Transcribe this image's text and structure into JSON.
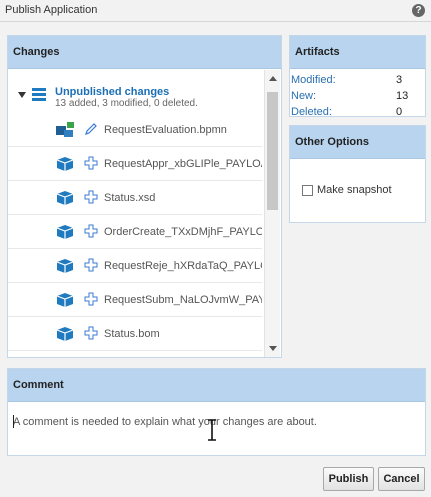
{
  "dialog": {
    "title": "Publish Application",
    "help_label": "?"
  },
  "changes": {
    "header": "Changes",
    "root": {
      "title": "Unpublished changes",
      "subtitle": "13 added, 3 modified, 0 deleted."
    },
    "items": [
      {
        "name": "RequestEvaluation.bpmn",
        "status": "modified",
        "icon": "process-icon"
      },
      {
        "name": "RequestAppr_xbGLIPle_PAYLOAD",
        "status": "added",
        "icon": "package-icon"
      },
      {
        "name": "Status.xsd",
        "status": "added",
        "icon": "package-icon"
      },
      {
        "name": "OrderCreate_TXxDMjhF_PAYLOAD",
        "status": "added",
        "icon": "package-icon"
      },
      {
        "name": "RequestReje_hXRdaTaQ_PAYLOAD",
        "status": "added",
        "icon": "package-icon"
      },
      {
        "name": "RequestSubm_NaLOJvmW_PAYLOAD",
        "status": "added",
        "icon": "package-icon"
      },
      {
        "name": "Status.bom",
        "status": "added",
        "icon": "package-icon"
      }
    ]
  },
  "artifacts": {
    "header": "Artifacts",
    "rows": [
      {
        "label": "Modified:",
        "value": "3"
      },
      {
        "label": "New:",
        "value": "13"
      },
      {
        "label": "Deleted:",
        "value": "0"
      }
    ]
  },
  "options": {
    "header": "Other Options",
    "snapshot_label": "Make snapshot",
    "snapshot_checked": false
  },
  "comment": {
    "header": "Comment",
    "placeholder": "A comment is needed to explain what your changes are about."
  },
  "buttons": {
    "publish": "Publish",
    "cancel": "Cancel"
  },
  "colors": {
    "header_bg": "#b8d4ee",
    "link": "#1a6fb5",
    "icon_blue": "#1f7ac0",
    "accent_green": "#3aa34a"
  }
}
